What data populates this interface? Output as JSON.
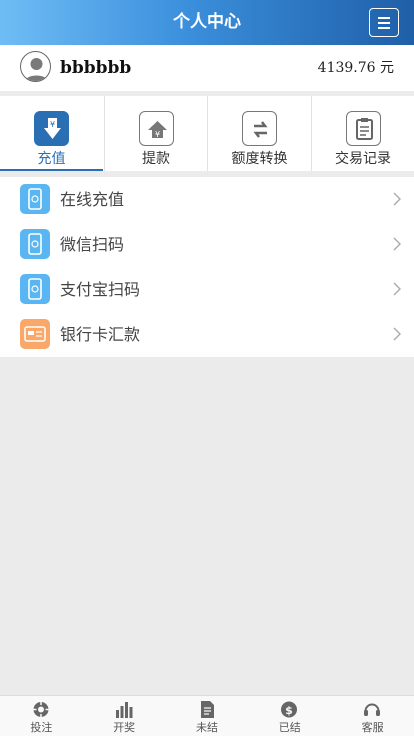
{
  "header": {
    "title": "个人中心"
  },
  "user": {
    "name": "bbbbbb",
    "balance": "4139.76 元"
  },
  "actions": [
    {
      "label": "充值",
      "icon": "deposit-icon"
    },
    {
      "label": "提款",
      "icon": "withdraw-icon"
    },
    {
      "label": "额度转换",
      "icon": "transfer-icon"
    },
    {
      "label": "交易记录",
      "icon": "records-icon"
    }
  ],
  "methods": [
    {
      "label": "在线充值",
      "icon": "phone-icon",
      "color": "#5ab6f3"
    },
    {
      "label": "微信扫码",
      "icon": "phone-icon",
      "color": "#5ab6f3"
    },
    {
      "label": "支付宝扫码",
      "icon": "phone-icon",
      "color": "#5ab6f3"
    },
    {
      "label": "银行卡汇款",
      "icon": "bank-card-icon",
      "color": "#f9a86a"
    }
  ],
  "tabs": [
    {
      "label": "投注",
      "icon": "chip-icon"
    },
    {
      "label": "开奖",
      "icon": "bar-chart-icon"
    },
    {
      "label": "未结",
      "icon": "document-icon"
    },
    {
      "label": "已结",
      "icon": "dollar-icon"
    },
    {
      "label": "客服",
      "icon": "headset-icon"
    }
  ],
  "colors": {
    "accent": "#2a6fb4",
    "header_start": "#6fbdf5",
    "header_end": "#1f5fa8"
  }
}
